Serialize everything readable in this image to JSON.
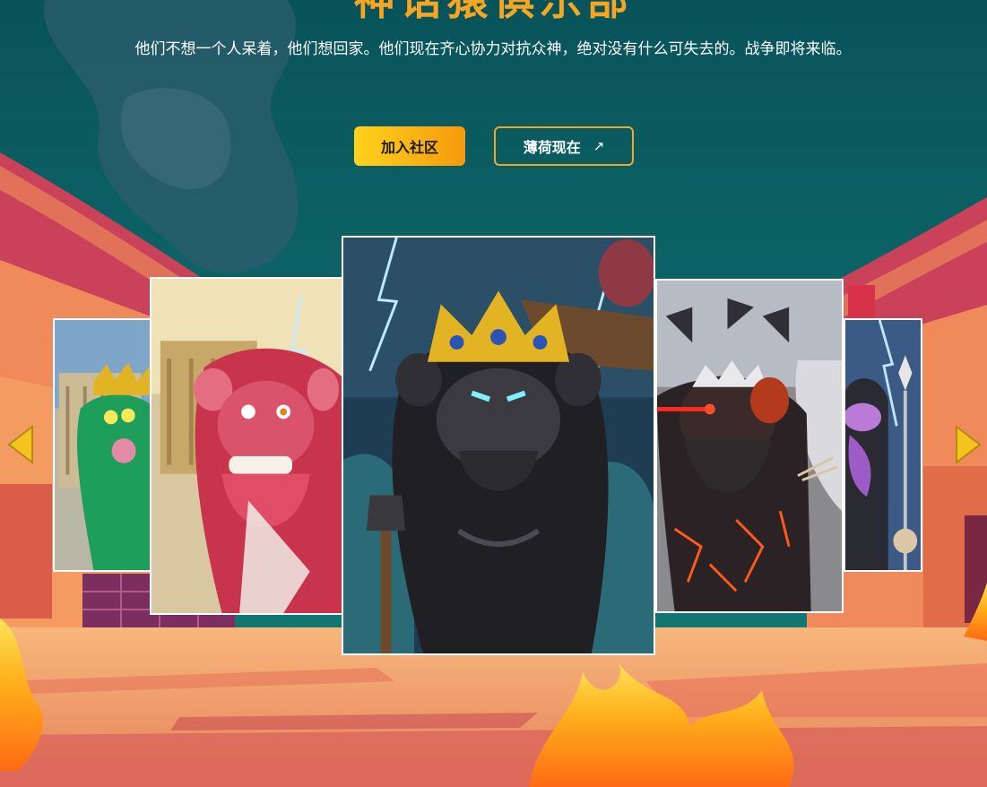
{
  "hero": {
    "title": "神话猿俱乐部",
    "description": "他们不想一个人呆着，他们想回家。他们现在齐心协力对抗众神，绝对没有什么可失去的。战争即将来临。"
  },
  "buttons": {
    "join_label": "加入社区",
    "mint_label": "薄荷现在",
    "mint_arrow": "↗"
  },
  "carousel": {
    "prev_icon": "chevron-left-icon",
    "next_icon": "chevron-right-icon",
    "cards": [
      {
        "name": "green-ape-card"
      },
      {
        "name": "red-ape-card"
      },
      {
        "name": "black-ape-card"
      },
      {
        "name": "lava-ape-card"
      },
      {
        "name": "purple-ape-card"
      }
    ]
  },
  "colors": {
    "accent": "#f6a623",
    "sky": "#0d5f63",
    "ground": "#f3a66a",
    "wall": "#e8744a"
  }
}
